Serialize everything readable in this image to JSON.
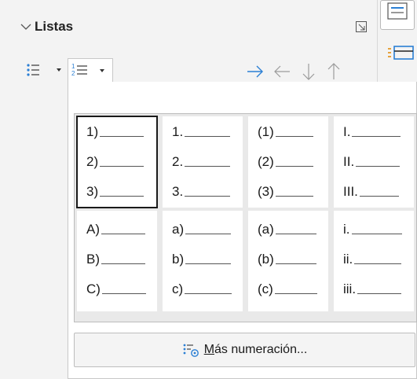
{
  "panel": {
    "title": "Listas"
  },
  "toolbar": {
    "bullets_icon": "unordered-list-icon",
    "numbering_icon": "ordered-list-icon",
    "arrows": [
      "demote-icon",
      "promote-icon",
      "move-down-icon",
      "move-up-icon"
    ]
  },
  "numbering_styles": [
    {
      "labels": [
        "1)",
        "2)",
        "3)"
      ],
      "selected": true
    },
    {
      "labels": [
        "1.",
        "2.",
        "3."
      ],
      "selected": false
    },
    {
      "labels": [
        "(1)",
        "(2)",
        "(3)"
      ],
      "selected": false
    },
    {
      "labels": [
        "I.",
        "II.",
        "III."
      ],
      "selected": false
    },
    {
      "labels": [
        "A)",
        "B)",
        "C)"
      ],
      "selected": false
    },
    {
      "labels": [
        "a)",
        "b)",
        "c)"
      ],
      "selected": false
    },
    {
      "labels": [
        "(a)",
        "(b)",
        "(c)"
      ],
      "selected": false
    },
    {
      "labels": [
        "i.",
        "ii.",
        "iii."
      ],
      "selected": false
    }
  ],
  "more_button": {
    "mnemonic": "M",
    "rest": "ás numeración..."
  },
  "colors": {
    "accent": "#2b7fd4",
    "arrow_disabled": "#9a9a9a"
  }
}
